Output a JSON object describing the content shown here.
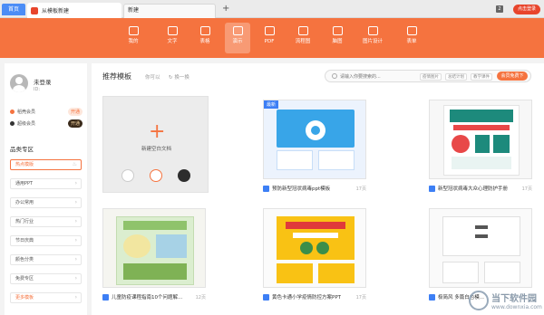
{
  "titlebar": {
    "home_tab": "首页",
    "doc_tab": "从模板新建",
    "new_tab": "新建",
    "add_tab": "+",
    "notif_count": "2",
    "login_btn": "点击登录"
  },
  "nav": {
    "items": [
      {
        "label": "我的",
        "icon": "home-icon"
      },
      {
        "label": "文字",
        "icon": "doc-icon"
      },
      {
        "label": "表格",
        "icon": "sheet-icon"
      },
      {
        "label": "演示",
        "icon": "presentation-icon",
        "active": true
      },
      {
        "label": "PDF",
        "icon": "pdf-icon"
      },
      {
        "label": "流程图",
        "icon": "flowchart-icon"
      },
      {
        "label": "脑图",
        "icon": "mindmap-icon"
      },
      {
        "label": "图片设计",
        "icon": "image-design-icon"
      },
      {
        "label": "表单",
        "icon": "form-icon"
      }
    ],
    "colors": {
      "bar": "#f5733f"
    }
  },
  "sidebar": {
    "user_name": "未登录",
    "user_id": "ID:",
    "members": [
      {
        "label": "稻壳会员",
        "button": "开通",
        "dot_color": "#f5733f",
        "btn_bg": "#fde6db",
        "btn_fg": "#f5733f"
      },
      {
        "label": "超级会员",
        "button": "开通",
        "dot_color": "#333333",
        "btn_bg": "#3a2a1a",
        "btn_fg": "#f3d3a0"
      }
    ],
    "section_title": "品类专区",
    "categories": [
      {
        "label": "热点模版",
        "active": true
      },
      {
        "label": "通用PPT"
      },
      {
        "label": "办公常用"
      },
      {
        "label": "热门行业"
      },
      {
        "label": "节日庆典"
      },
      {
        "label": "颜色分类"
      },
      {
        "label": "免费专区"
      },
      {
        "label": "更多模板",
        "accent": true
      }
    ]
  },
  "main": {
    "title": "推荐模板",
    "subtitle": "你可以",
    "refresh": "换一换",
    "search_placeholder": "请输入你要搜索的...",
    "tags": [
      "疫情图片",
      "总结计划",
      "教学课件"
    ],
    "vip_btn": "会员免费下",
    "blank": {
      "label": "新建空白文档"
    },
    "templates": [
      {
        "caption": "预防新型冠状病毒ppt模板",
        "pages": "17页",
        "badge": "最新"
      },
      {
        "caption": "新型冠状病毒大众心理防护手册",
        "pages": "17页"
      },
      {
        "caption": "儿童防疫课程指南10个问题解...",
        "pages": "12页"
      },
      {
        "caption": "黄色卡通小学疫情防控方案PPT",
        "pages": "17页"
      },
      {
        "caption": "极简风 多篇白色模...",
        "pages": ""
      }
    ]
  },
  "watermark": {
    "text": "当下软件园",
    "url": "www.downxia.com"
  }
}
